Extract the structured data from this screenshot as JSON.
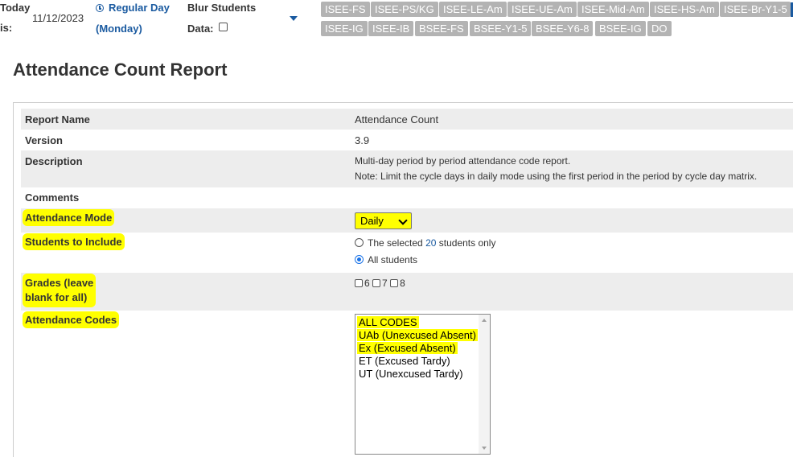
{
  "topbar": {
    "today_label": "Today",
    "is_label": "is:",
    "date": "11/12/2023",
    "day_type": "Regular Day",
    "weekday": "(Monday)",
    "blur_label": "Blur Students",
    "data_label": "Data:",
    "chips_row1": [
      "ISEE-FS",
      "ISEE-PS/KG",
      "ISEE-LE-Am",
      "ISEE-UE-Am",
      "ISEE-Mid-Am",
      "ISEE-HS-Am",
      "ISEE-Br-Y1-5"
    ],
    "chips_row2": [
      "ISEE-IG",
      "ISEE-IB",
      "BSEE-FS",
      "BSEE-Y1-5",
      "BSEE-Y6-8",
      "BSEE-IG",
      "DO"
    ]
  },
  "page_title": "Attendance Count Report",
  "report": {
    "name_label": "Report Name",
    "name_value": "Attendance Count",
    "version_label": "Version",
    "version_value": "3.9",
    "description_label": "Description",
    "description_line1": "Multi-day period by period attendance code report.",
    "description_line2": "Note: Limit the cycle days in daily mode using the first period in the period by cycle day matrix.",
    "comments_label": "Comments",
    "mode_label": "Attendance Mode",
    "mode_value": "Daily",
    "students_label": "Students to Include",
    "students_opt1_pre": "The selected",
    "students_opt1_count": "20",
    "students_opt1_post": "students only",
    "students_opt2": "All students",
    "grades_label_line1": "Grades (leave",
    "grades_label_line2": "blank for all)",
    "grades": [
      "6",
      "7",
      "8"
    ],
    "codes_label": "Attendance Codes",
    "codes": [
      "ALL CODES",
      "UAb (Unexcused Absent)",
      "Ex (Excused Absent)",
      "ET (Excused Tardy)",
      "UT (Unexcused Tardy)"
    ]
  },
  "colors": {
    "highlight": "#ffff00",
    "link": "#1a5aa0",
    "chip_bg": "#b3b3b3",
    "row_shade": "#ededed"
  }
}
